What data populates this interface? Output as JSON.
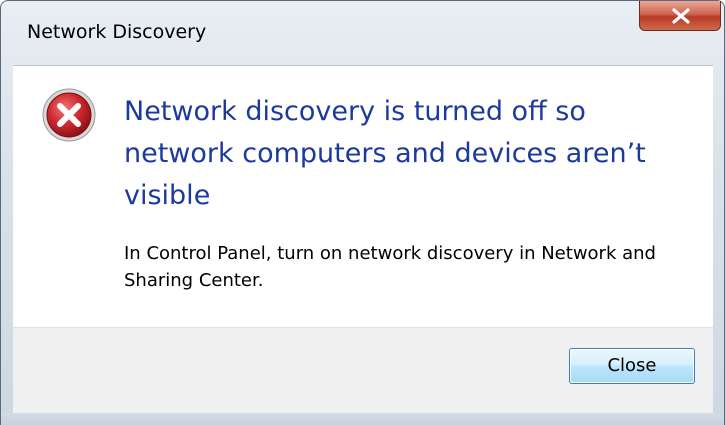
{
  "window": {
    "title": "Network Discovery"
  },
  "titlebar": {
    "close_icon": "close-x-icon"
  },
  "message": {
    "icon": "error-icon",
    "main_instruction": "Network discovery is turned off so network computers and devices aren’t visible",
    "content": "In Control Panel, turn on network discovery in Network and Sharing Center."
  },
  "footer": {
    "close_label": "Close"
  },
  "colors": {
    "main_instruction": "#1c3a9e",
    "error_red": "#c8242b",
    "close_button_border": "#3c7fb1"
  }
}
